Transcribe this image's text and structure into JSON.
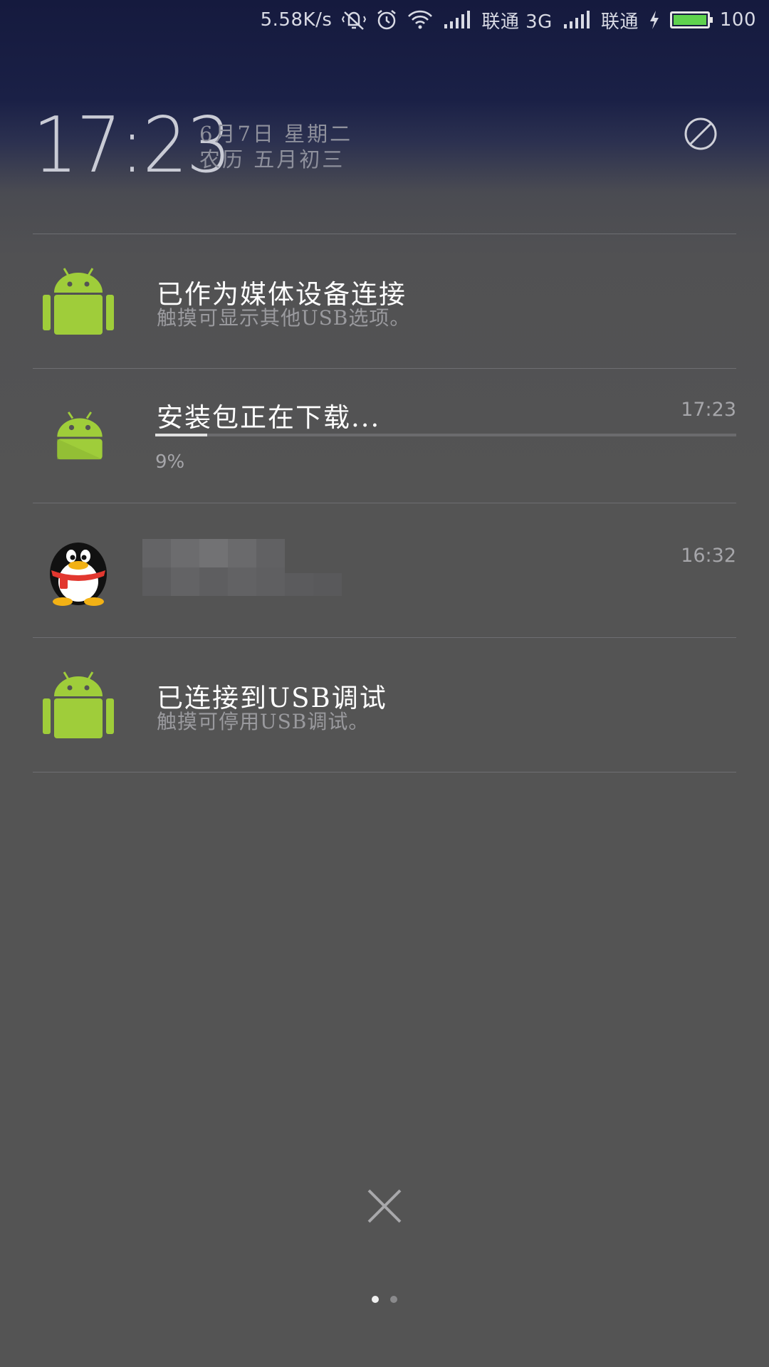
{
  "status_bar": {
    "net_speed": "5.58K/s",
    "carrier1": "联通 3G",
    "carrier2": "联通",
    "battery_level": "100",
    "battery_color": "#5fd24e",
    "icons": [
      "vibrate-mute-icon",
      "alarm-icon",
      "wifi-icon",
      "signal-icon",
      "signal-icon",
      "charging-icon",
      "battery-icon"
    ]
  },
  "header": {
    "time": "17:23",
    "date": "6月7日 星期二",
    "lunar": "农历 五月初三",
    "dnd_icon": "do-not-disturb-icon"
  },
  "notifications": [
    {
      "icon": "android-icon",
      "title": "已作为媒体设备连接",
      "subtitle": "触摸可显示其他USB选项。"
    },
    {
      "icon": "android-icon",
      "title": "安装包正在下载...",
      "time": "17:23",
      "progress": 0.09,
      "progress_label": "9%"
    },
    {
      "icon": "qq-penguin-icon",
      "time": "16:32"
    },
    {
      "icon": "android-icon",
      "title": "已连接到USB调试",
      "subtitle": "触摸可停用USB调试。"
    }
  ],
  "footer": {
    "clear_icon": "close-icon",
    "pages": 2,
    "active_page": 1
  },
  "colors": {
    "android_green": "#9fcd3a",
    "accent_text": "#ffffff"
  }
}
